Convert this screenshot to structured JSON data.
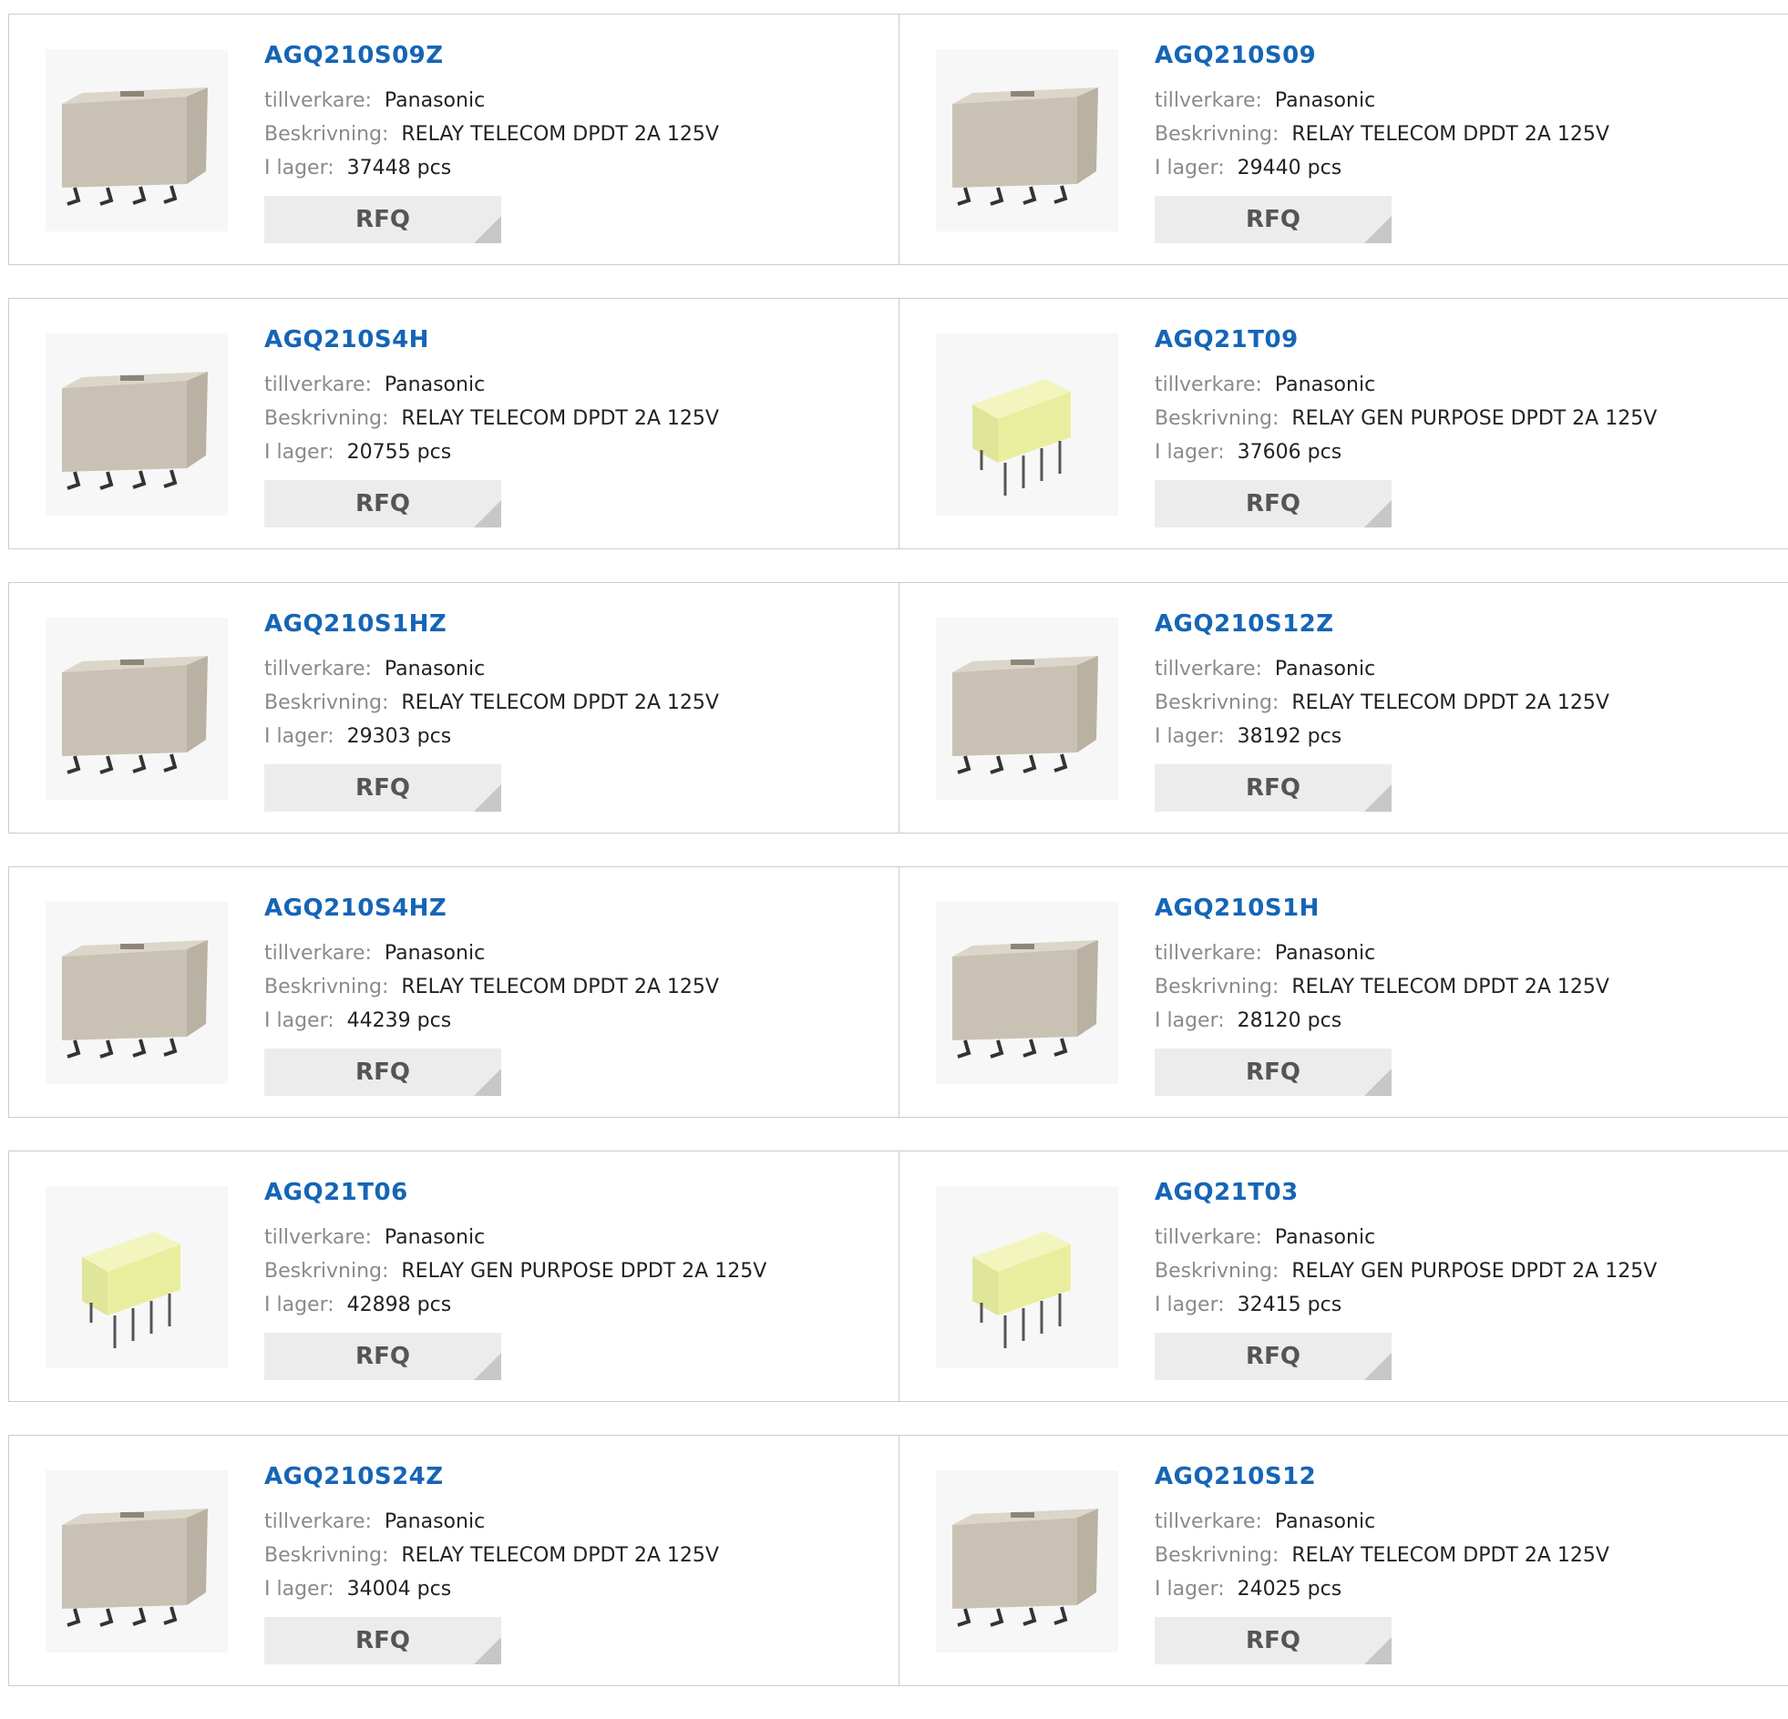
{
  "labels": {
    "manufacturer": "tillverkare:",
    "description": "Beskrivning:",
    "stock": "I lager:",
    "rfq": "RFQ"
  },
  "products": [
    {
      "part": "AGQ210S09Z",
      "manufacturer": "Panasonic",
      "description": "RELAY TELECOM DPDT 2A 125V",
      "stock": "37448 pcs",
      "image": "smd-relay-icon"
    },
    {
      "part": "AGQ210S09",
      "manufacturer": "Panasonic",
      "description": "RELAY TELECOM DPDT 2A 125V",
      "stock": "29440 pcs",
      "image": "smd-relay-icon"
    },
    {
      "part": "AGQ210S4H",
      "manufacturer": "Panasonic",
      "description": "RELAY TELECOM DPDT 2A 125V",
      "stock": "20755 pcs",
      "image": "smd-relay-icon"
    },
    {
      "part": "AGQ21T09",
      "manufacturer": "Panasonic",
      "description": "RELAY GEN PURPOSE DPDT 2A 125V",
      "stock": "37606 pcs",
      "image": "tht-relay-icon"
    },
    {
      "part": "AGQ210S1HZ",
      "manufacturer": "Panasonic",
      "description": "RELAY TELECOM DPDT 2A 125V",
      "stock": "29303 pcs",
      "image": "smd-relay-icon"
    },
    {
      "part": "AGQ210S12Z",
      "manufacturer": "Panasonic",
      "description": "RELAY TELECOM DPDT 2A 125V",
      "stock": "38192 pcs",
      "image": "smd-relay-icon"
    },
    {
      "part": "AGQ210S4HZ",
      "manufacturer": "Panasonic",
      "description": "RELAY TELECOM DPDT 2A 125V",
      "stock": "44239 pcs",
      "image": "smd-relay-icon"
    },
    {
      "part": "AGQ210S1H",
      "manufacturer": "Panasonic",
      "description": "RELAY TELECOM DPDT 2A 125V",
      "stock": "28120 pcs",
      "image": "smd-relay-icon"
    },
    {
      "part": "AGQ21T06",
      "manufacturer": "Panasonic",
      "description": "RELAY GEN PURPOSE DPDT 2A 125V",
      "stock": "42898 pcs",
      "image": "tht-relay-icon"
    },
    {
      "part": "AGQ21T03",
      "manufacturer": "Panasonic",
      "description": "RELAY GEN PURPOSE DPDT 2A 125V",
      "stock": "32415 pcs",
      "image": "tht-relay-icon"
    },
    {
      "part": "AGQ210S24Z",
      "manufacturer": "Panasonic",
      "description": "RELAY TELECOM DPDT 2A 125V",
      "stock": "34004 pcs",
      "image": "smd-relay-icon"
    },
    {
      "part": "AGQ210S12",
      "manufacturer": "Panasonic",
      "description": "RELAY TELECOM DPDT 2A 125V",
      "stock": "24025 pcs",
      "image": "smd-relay-icon"
    }
  ],
  "colors": {
    "title": "#1565b6",
    "label": "#8a8a8a",
    "button_bg": "#ececec",
    "border": "#cccccc"
  }
}
